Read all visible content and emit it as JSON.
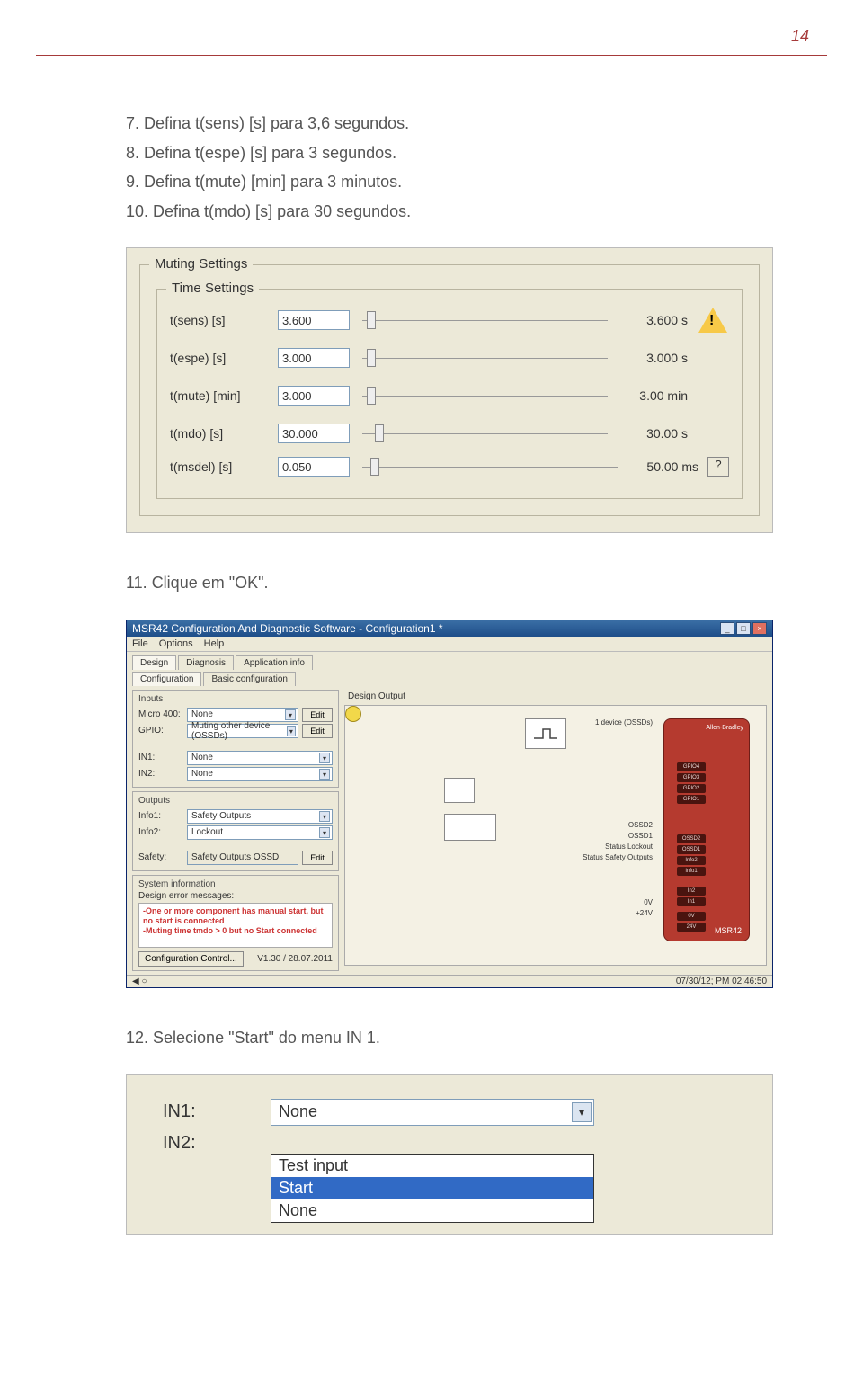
{
  "page_number": "14",
  "steps": {
    "s7": "7. Defina t(sens) [s] para 3,6 segundos.",
    "s8": "8. Defina t(espe) [s] para 3 segundos.",
    "s9": "9. Defina t(mute) [min] para 3 minutos.",
    "s10": "10. Defina t(mdo) [s] para 30 segundos.",
    "s11": "11. Clique em \"OK\".",
    "s12": "12. Selecione \"Start\" do menu IN 1."
  },
  "muting_settings": {
    "group_outer": "Muting Settings",
    "group_inner": "Time Settings",
    "rows": [
      {
        "label": "t(sens) [s]",
        "value": "3.600",
        "calc": "3.600 s",
        "warn": true
      },
      {
        "label": "t(espe) [s]",
        "value": "3.000",
        "calc": "3.000 s",
        "warn": false
      },
      {
        "label": "t(mute) [min]",
        "value": "3.000",
        "calc": "3.00 min",
        "warn": false
      },
      {
        "label": "t(mdo) [s]",
        "value": "30.000",
        "calc": "30.00 s",
        "warn": false
      },
      {
        "label": "t(msdel) [s]",
        "value": "0.050",
        "calc": "50.00 ms",
        "help": "?"
      }
    ]
  },
  "app_window": {
    "title": "MSR42 Configuration And Diagnostic Software - Configuration1 *",
    "menu": [
      "File",
      "Options",
      "Help"
    ],
    "tabs_top": [
      "Design",
      "Diagnosis",
      "Application info"
    ],
    "tabs_sub": [
      "Configuration",
      "Basic configuration"
    ],
    "inputs_title": "Inputs",
    "micro400_label": "Micro 400:",
    "micro400_value": "None",
    "micro400_edit": "Edit",
    "gpio_label": "GPIO:",
    "gpio_value": "Muting other device (OSSDs)",
    "gpio_edit": "Edit",
    "in1_label": "IN1:",
    "in1_value": "None",
    "in2_label": "IN2:",
    "in2_value": "None",
    "outputs_title": "Outputs",
    "info1_label": "Info1:",
    "info1_value": "Safety Outputs",
    "info2_label": "Info2:",
    "info2_value": "Lockout",
    "safety_label": "Safety:",
    "safety_value": "Safety Outputs OSSD",
    "safety_edit": "Edit",
    "sysinfo_title": "System information",
    "err_label": "Design error messages:",
    "err_lines": [
      "-One or more component has manual start, but no start is connected",
      "-Muting time tmdo > 0 but no Start connected"
    ],
    "conf_control_btn": "Configuration Control...",
    "version": "V1.30 / 28.07.2011",
    "design_output_title": "Design Output",
    "io_labels": {
      "top_left": "1 device (OSSDs)",
      "top_right": "+24V",
      "lamp": "Lamp",
      "gpio4": "GPIO4",
      "gpio3": "GPIO3",
      "gpio2": "GPIO2",
      "gpio1": "GPIO1",
      "ossd2": "OSSD2",
      "ossd1": "OSSD1",
      "status_lockout": "Status Lockout",
      "status_safety": "Status Safety Outputs",
      "in2": "In2",
      "in1": "In1",
      "ov": "0V",
      "p24v": "+24V"
    },
    "module_brand": "Allen-Bradley",
    "module_name": "MSR42",
    "status_right": "07/30/12; PM 02:46:50"
  },
  "in_dropdown": {
    "in1_label": "IN1:",
    "in1_value": "None",
    "in2_label": "IN2:",
    "options": [
      "Test input",
      "Start",
      "None"
    ],
    "selected": "Start"
  }
}
